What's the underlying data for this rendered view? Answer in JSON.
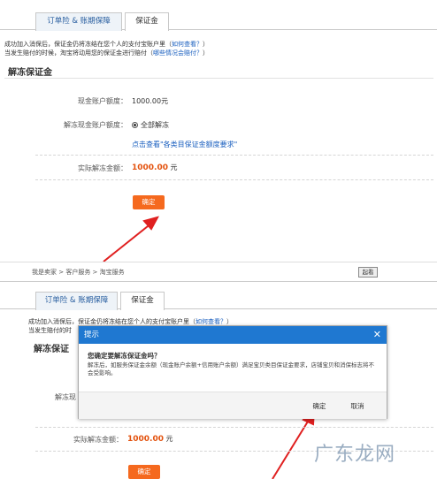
{
  "top": {
    "tabs": [
      {
        "label": "订单险 & 账期保障"
      },
      {
        "label": "保证金"
      }
    ],
    "notice_line1_prefix": "成功加入消保后，保证金仍将冻结在您个人的支付宝账户里（",
    "notice_line1_link": "如何查看？",
    "notice_line1_suffix": "）",
    "notice_line2_prefix": "当发生赔付的时候，淘宝将动用您的保证金进行赔付（",
    "notice_line2_link": "哪些情况会赔付？",
    "notice_line2_suffix": "）",
    "section_title": "解冻保证金",
    "cash_label": "现金账户额度：",
    "cash_value": "1000.00元",
    "unfreeze_label": "解冻现金账户额度：",
    "unfreeze_option": "全部解冻",
    "requirement_link": "点击查看\"各类目保证金额度要求\"",
    "actual_label": "实际解冻金额：",
    "actual_amount": "1000.00",
    "actual_unit": "元",
    "confirm_button": "确定"
  },
  "bottom": {
    "breadcrumb": "我是卖家 > 客户服务 > 淘宝服务",
    "search_button": "起看",
    "tabs": [
      {
        "label": "订单险 & 账期保障"
      },
      {
        "label": "保证金"
      }
    ],
    "notice_line1_prefix": "成功加入消保后，保证金仍将冻结在您个人的支付宝账户里（",
    "notice_line1_link": "如何查看？",
    "notice_line1_suffix": "）",
    "notice_line2_partial": "当发生赔付的时",
    "section_title_partial": "解冻保证",
    "unfreeze_label_partial": "解冻现",
    "actual_label": "实际解冻金额：",
    "actual_amount": "1000.00",
    "actual_unit": "元",
    "confirm_button": "确定"
  },
  "dialog": {
    "title": "提示",
    "close": "✕",
    "question": "您确定要解冻保证金吗？",
    "description": "解冻后，如服务保证金余额（现金账户余额+信用账户余额）满足宝贝类目保证金要求，店铺宝贝和消保标志将不会受影响。",
    "ok_button": "确定",
    "cancel_button": "取消"
  },
  "watermark": "广东龙网",
  "colors": {
    "accent": "#f5691e",
    "link": "#1a5fbf",
    "dialog_header": "#1f78d1",
    "amount": "#e3520e",
    "arrow": "#e02020"
  }
}
